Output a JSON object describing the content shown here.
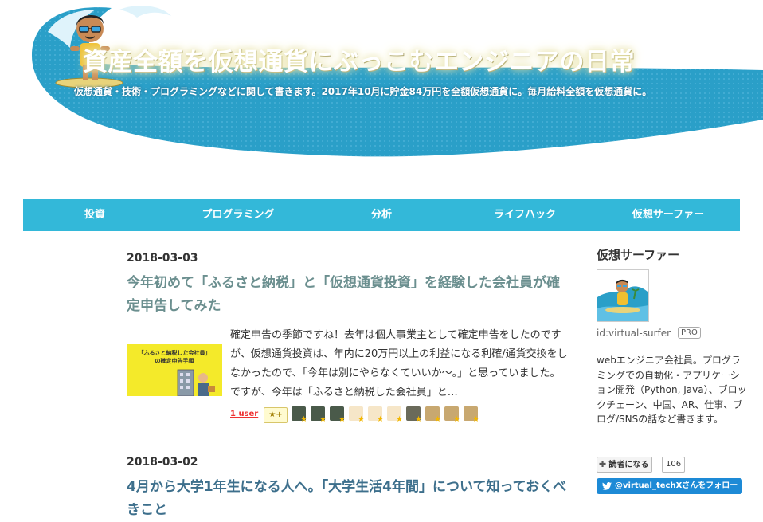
{
  "header": {
    "title": "資産全額を仮想通貨にぶっこむエンジニアの日常",
    "description": "仮想通貨・技術・プログラミングなどに関して書きます。2017年10月に貯金84万円を全額仮想通貨に。毎月給料全額を仮想通貨に。"
  },
  "nav": {
    "items": [
      {
        "label": "投資"
      },
      {
        "label": "プログラミング"
      },
      {
        "label": "分析"
      },
      {
        "label": "ライフハック"
      },
      {
        "label": "仮想サーファー"
      }
    ]
  },
  "entries": [
    {
      "date": "2018-03-03",
      "title": "今年初めて「ふるさと納税」と「仮想通貨投資」を経験した会社員が確定申告してみた",
      "thumb_lines": [
        "「ふるさと納税した会社員」",
        "の確定申告手順"
      ],
      "excerpt": "確定申告の季節ですね！去年は個人事業主として確定申告をしたのですが、仮想通貨投資は、年内に20万円以上の利益になる利確/通貨交換をしなかったので、「今年は別にやらなくていいか〜。」と思っていました。 ですが、今年は「ふるさと納税した会社員」と…",
      "star_users": "1 user",
      "add_star": "★+"
    },
    {
      "date": "2018-03-02",
      "title": "4月から大学1年生になる人へ。「大学生活4年間」について知っておくべきこと"
    }
  ],
  "sidebar": {
    "title": "仮想サーファー",
    "user_id": "id:virtual-surfer",
    "pro_badge": "PRO",
    "bio": "webエンジニア会社員。プログラミングでの自動化・アプリケーション開発（Python, Java）、ブロックチェーン、中国、AR、仕事、ブログ/SNSの話など書きます。",
    "subscribe_label": "読者になる",
    "subscribe_icon": "plus-icon",
    "subscribe_count": "106",
    "twitter_label": "@virtual_techXさんをフォロー",
    "twitter_icon": "twitter-bird-icon"
  },
  "colors": {
    "nav_bg": "#33b8d9",
    "title_link": "#6b8f8f",
    "title_link_2": "#3d6f8c",
    "twitter": "#1d8ad6",
    "wave": "#2a9fc8"
  }
}
